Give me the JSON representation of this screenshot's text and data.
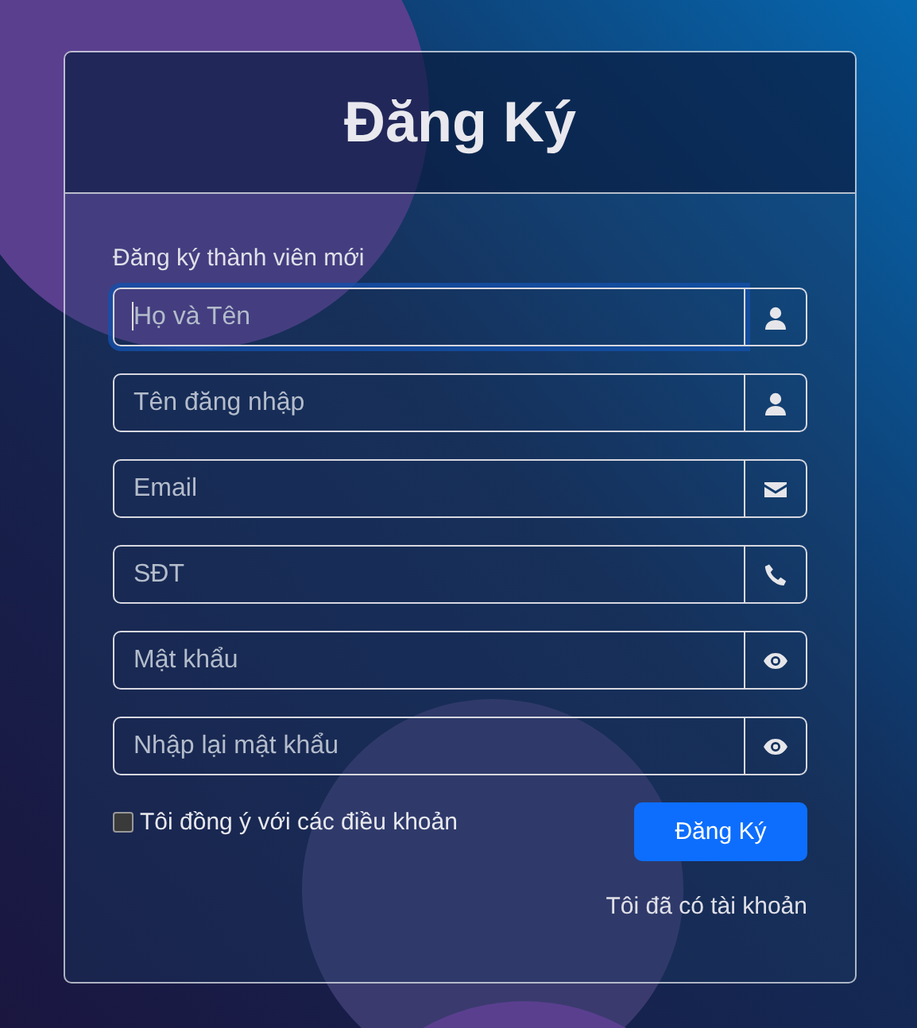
{
  "title": "Đăng Ký",
  "subtitle": "Đăng ký thành viên mới",
  "fields": [
    {
      "placeholder": "Họ và Tên",
      "kind": "user",
      "focused": true
    },
    {
      "placeholder": "Tên đăng nhập",
      "kind": "user",
      "focused": false
    },
    {
      "placeholder": "Email",
      "kind": "envelope",
      "focused": false
    },
    {
      "placeholder": "SĐT",
      "kind": "phone",
      "focused": false
    },
    {
      "placeholder": "Mật khẩu",
      "kind": "eye",
      "focused": false
    },
    {
      "placeholder": "Nhập lại mật khẩu",
      "kind": "eye",
      "focused": false
    }
  ],
  "terms": {
    "label": "Tôi đồng ý với các điều khoản",
    "checked": false
  },
  "submit": "Đăng Ký",
  "login_link": "Tôi đã có tài khoản"
}
